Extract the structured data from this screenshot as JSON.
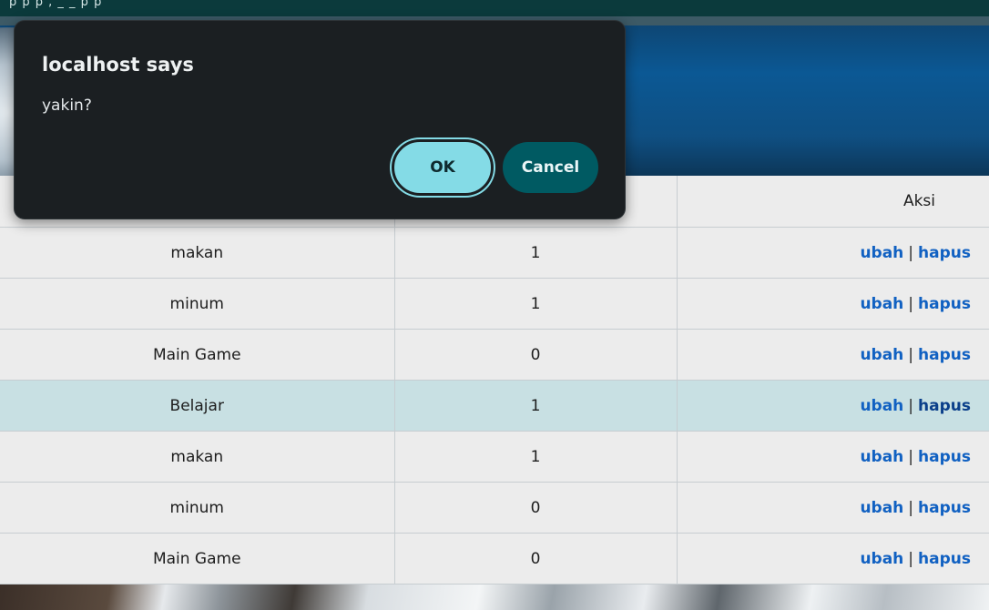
{
  "browser": {
    "top_strip_text": "p p p , _ _ p p"
  },
  "dialog": {
    "title": "localhost says",
    "message": "yakin?",
    "ok_label": "OK",
    "cancel_label": "Cancel"
  },
  "table": {
    "columns": [
      "",
      "",
      "Aksi"
    ],
    "rows": [
      {
        "name": "makan",
        "status": "1",
        "edit": "ubah",
        "sep": "|",
        "delete": "hapus"
      },
      {
        "name": "minum",
        "status": "1",
        "edit": "ubah",
        "sep": "|",
        "delete": "hapus"
      },
      {
        "name": "Main Game",
        "status": "0",
        "edit": "ubah",
        "sep": "|",
        "delete": "hapus"
      },
      {
        "name": "Belajar",
        "status": "1",
        "edit": "ubah",
        "sep": "|",
        "delete": "hapus"
      },
      {
        "name": "makan",
        "status": "1",
        "edit": "ubah",
        "sep": "|",
        "delete": "hapus"
      },
      {
        "name": "minum",
        "status": "0",
        "edit": "ubah",
        "sep": "|",
        "delete": "hapus"
      },
      {
        "name": "Main Game",
        "status": "0",
        "edit": "ubah",
        "sep": "|",
        "delete": "hapus"
      }
    ],
    "highlighted_row": 3
  },
  "colors": {
    "link": "#1161c2",
    "dialog_bg": "#1b1f22",
    "ok_button": "#84dbe6",
    "cancel_button": "#005a62",
    "highlight_row": "#c8e0e3"
  }
}
